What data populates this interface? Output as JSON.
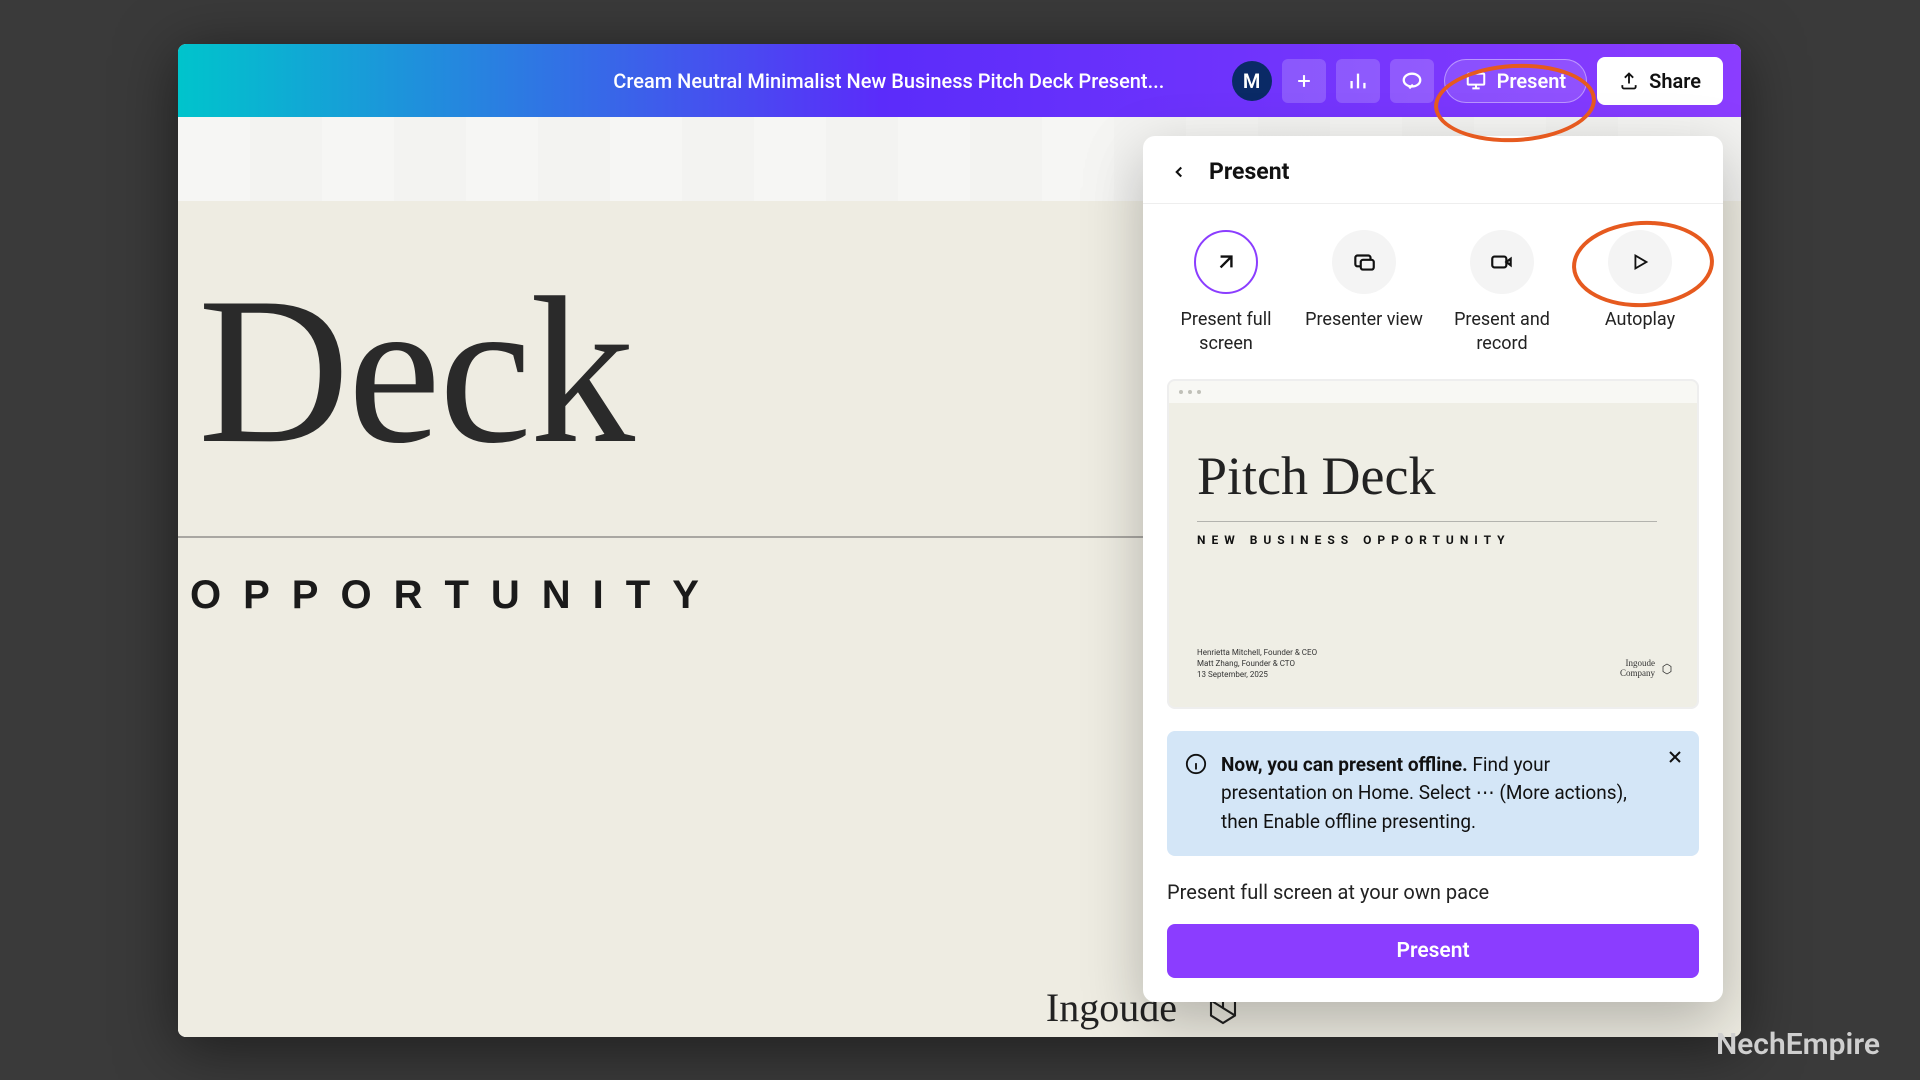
{
  "header": {
    "doc_title": "Cream Neutral Minimalist New Business Pitch Deck Present...",
    "avatar_letter": "M",
    "present_label": "Present",
    "share_label": "Share"
  },
  "canvas": {
    "title": "Deck",
    "subtitle": "OPPORTUNITY",
    "brand": "Ingoude"
  },
  "panel": {
    "title": "Present",
    "modes": [
      {
        "label": "Present full screen"
      },
      {
        "label": "Presenter view"
      },
      {
        "label": "Present and record"
      },
      {
        "label": "Autoplay"
      }
    ],
    "preview": {
      "title": "Pitch Deck",
      "subtitle": "NEW BUSINESS OPPORTUNITY",
      "credit1": "Henrietta Mitchell, Founder & CEO",
      "credit2": "Matt Zhang, Founder & CTO",
      "credit3": "13 September, 2025",
      "brand1": "Ingoude",
      "brand2": "Company"
    },
    "info": {
      "bold": "Now, you can present offline.",
      "rest": " Find your presentation on Home. Select ⋯ (More actions), then Enable offline presenting."
    },
    "help": "Present full screen at your own pace",
    "present_button": "Present"
  },
  "watermark": "NechEmpire"
}
